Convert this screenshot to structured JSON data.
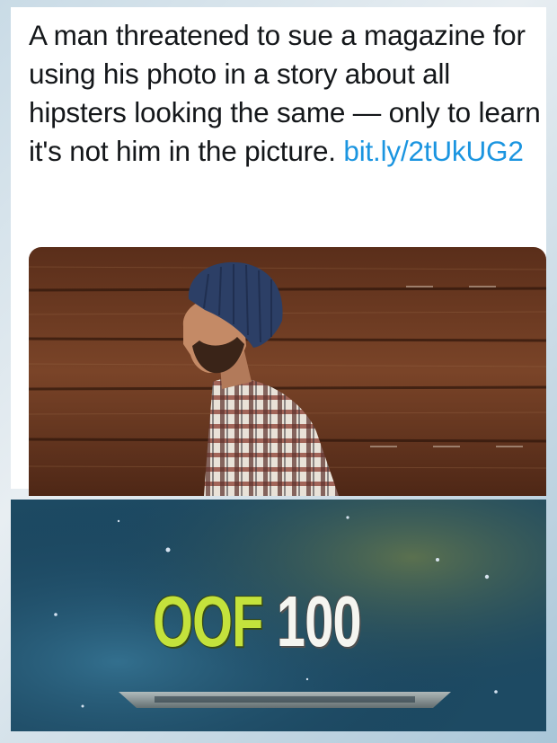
{
  "tweet": {
    "text": "A man threatened to sue a magazine for using his photo in a story about all hipsters looking the same — only to learn it's not him in the picture.",
    "link": "bit.ly/2tUkUG2"
  },
  "meme": {
    "word": "OOF",
    "level": "100"
  },
  "colors": {
    "link": "#1b95e0",
    "oof_green": "#c4e23c",
    "wood": "#6b3a22",
    "nebula": "#1d4a63"
  },
  "icons": {
    "photo": "man-in-beanie-profile",
    "meme_background": "skyrim-skill-nebula"
  }
}
